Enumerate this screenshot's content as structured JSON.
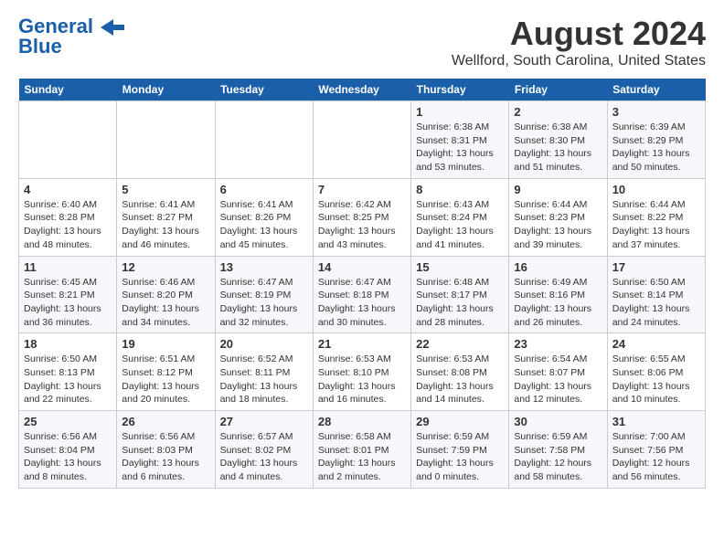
{
  "logo": {
    "line1": "General",
    "line2": "Blue"
  },
  "title": "August 2024",
  "subtitle": "Wellford, South Carolina, United States",
  "days_of_week": [
    "Sunday",
    "Monday",
    "Tuesday",
    "Wednesday",
    "Thursday",
    "Friday",
    "Saturday"
  ],
  "weeks": [
    [
      {
        "day": "",
        "info": ""
      },
      {
        "day": "",
        "info": ""
      },
      {
        "day": "",
        "info": ""
      },
      {
        "day": "",
        "info": ""
      },
      {
        "day": "1",
        "info": "Sunrise: 6:38 AM\nSunset: 8:31 PM\nDaylight: 13 hours\nand 53 minutes."
      },
      {
        "day": "2",
        "info": "Sunrise: 6:38 AM\nSunset: 8:30 PM\nDaylight: 13 hours\nand 51 minutes."
      },
      {
        "day": "3",
        "info": "Sunrise: 6:39 AM\nSunset: 8:29 PM\nDaylight: 13 hours\nand 50 minutes."
      }
    ],
    [
      {
        "day": "4",
        "info": "Sunrise: 6:40 AM\nSunset: 8:28 PM\nDaylight: 13 hours\nand 48 minutes."
      },
      {
        "day": "5",
        "info": "Sunrise: 6:41 AM\nSunset: 8:27 PM\nDaylight: 13 hours\nand 46 minutes."
      },
      {
        "day": "6",
        "info": "Sunrise: 6:41 AM\nSunset: 8:26 PM\nDaylight: 13 hours\nand 45 minutes."
      },
      {
        "day": "7",
        "info": "Sunrise: 6:42 AM\nSunset: 8:25 PM\nDaylight: 13 hours\nand 43 minutes."
      },
      {
        "day": "8",
        "info": "Sunrise: 6:43 AM\nSunset: 8:24 PM\nDaylight: 13 hours\nand 41 minutes."
      },
      {
        "day": "9",
        "info": "Sunrise: 6:44 AM\nSunset: 8:23 PM\nDaylight: 13 hours\nand 39 minutes."
      },
      {
        "day": "10",
        "info": "Sunrise: 6:44 AM\nSunset: 8:22 PM\nDaylight: 13 hours\nand 37 minutes."
      }
    ],
    [
      {
        "day": "11",
        "info": "Sunrise: 6:45 AM\nSunset: 8:21 PM\nDaylight: 13 hours\nand 36 minutes."
      },
      {
        "day": "12",
        "info": "Sunrise: 6:46 AM\nSunset: 8:20 PM\nDaylight: 13 hours\nand 34 minutes."
      },
      {
        "day": "13",
        "info": "Sunrise: 6:47 AM\nSunset: 8:19 PM\nDaylight: 13 hours\nand 32 minutes."
      },
      {
        "day": "14",
        "info": "Sunrise: 6:47 AM\nSunset: 8:18 PM\nDaylight: 13 hours\nand 30 minutes."
      },
      {
        "day": "15",
        "info": "Sunrise: 6:48 AM\nSunset: 8:17 PM\nDaylight: 13 hours\nand 28 minutes."
      },
      {
        "day": "16",
        "info": "Sunrise: 6:49 AM\nSunset: 8:16 PM\nDaylight: 13 hours\nand 26 minutes."
      },
      {
        "day": "17",
        "info": "Sunrise: 6:50 AM\nSunset: 8:14 PM\nDaylight: 13 hours\nand 24 minutes."
      }
    ],
    [
      {
        "day": "18",
        "info": "Sunrise: 6:50 AM\nSunset: 8:13 PM\nDaylight: 13 hours\nand 22 minutes."
      },
      {
        "day": "19",
        "info": "Sunrise: 6:51 AM\nSunset: 8:12 PM\nDaylight: 13 hours\nand 20 minutes."
      },
      {
        "day": "20",
        "info": "Sunrise: 6:52 AM\nSunset: 8:11 PM\nDaylight: 13 hours\nand 18 minutes."
      },
      {
        "day": "21",
        "info": "Sunrise: 6:53 AM\nSunset: 8:10 PM\nDaylight: 13 hours\nand 16 minutes."
      },
      {
        "day": "22",
        "info": "Sunrise: 6:53 AM\nSunset: 8:08 PM\nDaylight: 13 hours\nand 14 minutes."
      },
      {
        "day": "23",
        "info": "Sunrise: 6:54 AM\nSunset: 8:07 PM\nDaylight: 13 hours\nand 12 minutes."
      },
      {
        "day": "24",
        "info": "Sunrise: 6:55 AM\nSunset: 8:06 PM\nDaylight: 13 hours\nand 10 minutes."
      }
    ],
    [
      {
        "day": "25",
        "info": "Sunrise: 6:56 AM\nSunset: 8:04 PM\nDaylight: 13 hours\nand 8 minutes."
      },
      {
        "day": "26",
        "info": "Sunrise: 6:56 AM\nSunset: 8:03 PM\nDaylight: 13 hours\nand 6 minutes."
      },
      {
        "day": "27",
        "info": "Sunrise: 6:57 AM\nSunset: 8:02 PM\nDaylight: 13 hours\nand 4 minutes."
      },
      {
        "day": "28",
        "info": "Sunrise: 6:58 AM\nSunset: 8:01 PM\nDaylight: 13 hours\nand 2 minutes."
      },
      {
        "day": "29",
        "info": "Sunrise: 6:59 AM\nSunset: 7:59 PM\nDaylight: 13 hours\nand 0 minutes."
      },
      {
        "day": "30",
        "info": "Sunrise: 6:59 AM\nSunset: 7:58 PM\nDaylight: 12 hours\nand 58 minutes."
      },
      {
        "day": "31",
        "info": "Sunrise: 7:00 AM\nSunset: 7:56 PM\nDaylight: 12 hours\nand 56 minutes."
      }
    ]
  ]
}
